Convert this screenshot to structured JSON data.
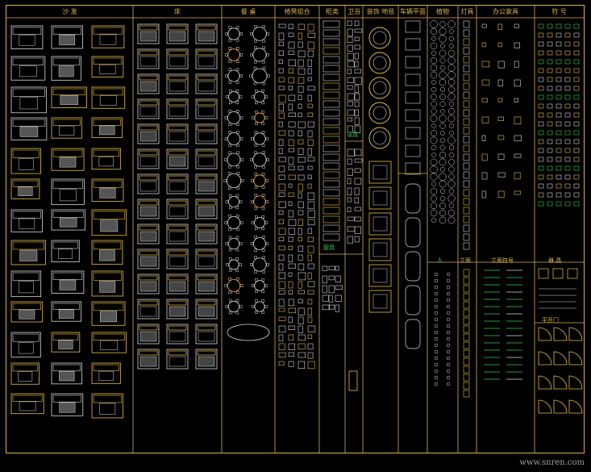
{
  "sheet": {
    "background": "#000000",
    "frame_color": "#d9b24e",
    "watermark": "www.snren.com"
  },
  "columns": [
    {
      "key": "sofa",
      "header": "沙 发"
    },
    {
      "key": "bed",
      "header": "床"
    },
    {
      "key": "dining",
      "header": "餐 桌"
    },
    {
      "key": "chairs",
      "header": "椅凳组合"
    },
    {
      "key": "cabinet",
      "header": "柜类"
    },
    {
      "key": "bath",
      "header": "卫浴"
    },
    {
      "key": "carpet",
      "header": "装饰 地毯"
    },
    {
      "key": "vehicle",
      "header": "车辆平面"
    },
    {
      "key": "plants",
      "header": "植物"
    },
    {
      "key": "lamp",
      "header": "灯具"
    },
    {
      "key": "office",
      "header": "办公家具"
    },
    {
      "key": "symbols",
      "header": "符 号"
    }
  ],
  "subheaders": {
    "bath_lower": "厨具",
    "bath_mid": "洁具",
    "plants_lower": "人",
    "lamp_lower": "立面",
    "office_lower": "立面符号",
    "symbols_lower": "器 具",
    "symbols_doors": "平开门"
  },
  "colors": {
    "yellow": "#e8bf45",
    "white": "#d8d8d8",
    "gray": "#a8a8a8",
    "green": "#2fd14c",
    "orange": "#ffa21a"
  }
}
